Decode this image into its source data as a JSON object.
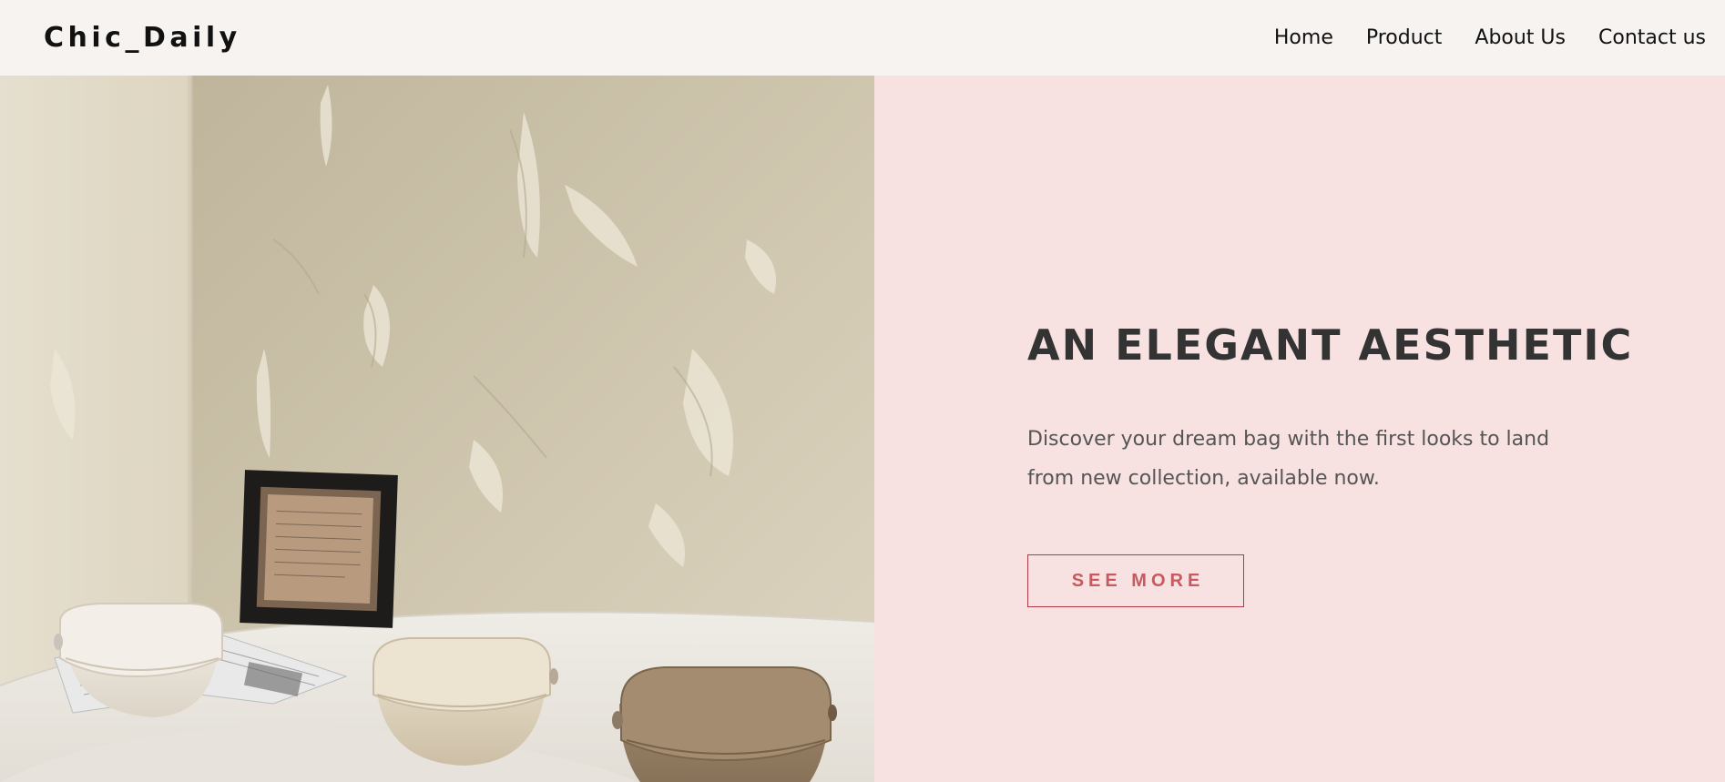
{
  "brand": {
    "logo_text": "Chic_Daily"
  },
  "nav": {
    "items": [
      {
        "label": "Home"
      },
      {
        "label": "Product"
      },
      {
        "label": "About Us"
      },
      {
        "label": "Contact us"
      }
    ]
  },
  "hero": {
    "headline": "AN ELEGANT AESTHETIC",
    "description": "Discover your dream bag with the first looks to land from new collection, available now.",
    "cta_label": "SEE MORE",
    "image": {
      "subject": "handbags-on-table-photo"
    }
  },
  "colors": {
    "nav_background": "#f7f3f1",
    "hero_panel_background": "#f8e1e1",
    "headline": "#333333",
    "body_text": "#555555",
    "cta_border": "#b03a48",
    "cta_text": "#c65a60"
  }
}
